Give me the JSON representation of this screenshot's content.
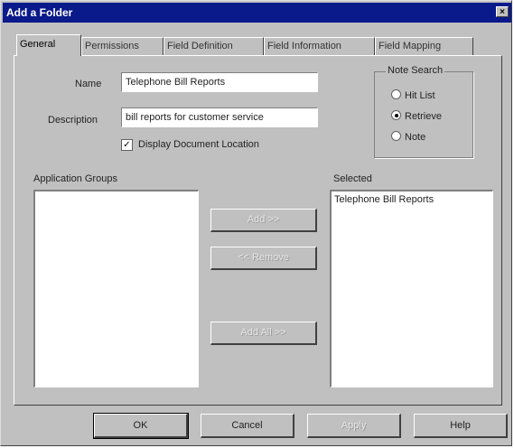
{
  "window": {
    "title": "Add a Folder",
    "close_glyph": "×"
  },
  "tabs": [
    "General",
    "Permissions",
    "Field Definition",
    "Field Information",
    "Field Mapping"
  ],
  "general": {
    "name_label": "Name",
    "name_value": "Telephone Bill Reports",
    "description_label": "Description",
    "description_value": "bill reports for customer service",
    "display_location_label": "Display Document Location",
    "display_location_checked": true,
    "note_search": {
      "title": "Note Search",
      "options": [
        "Hit List",
        "Retrieve",
        "Note"
      ],
      "selected": "Retrieve"
    },
    "application_groups_label": "Application Groups",
    "application_groups_items": [],
    "selected_label": "Selected",
    "selected_items": [
      "Telephone Bill Reports"
    ],
    "add_button": "Add >>",
    "remove_button": "<< Remove",
    "add_all_button": "Add All >>"
  },
  "buttons": {
    "ok": "OK",
    "cancel": "Cancel",
    "apply": "Apply",
    "help": "Help"
  },
  "colors": {
    "title_bar": "#0a1a8a",
    "dialog_face": "#c0c0c0"
  }
}
